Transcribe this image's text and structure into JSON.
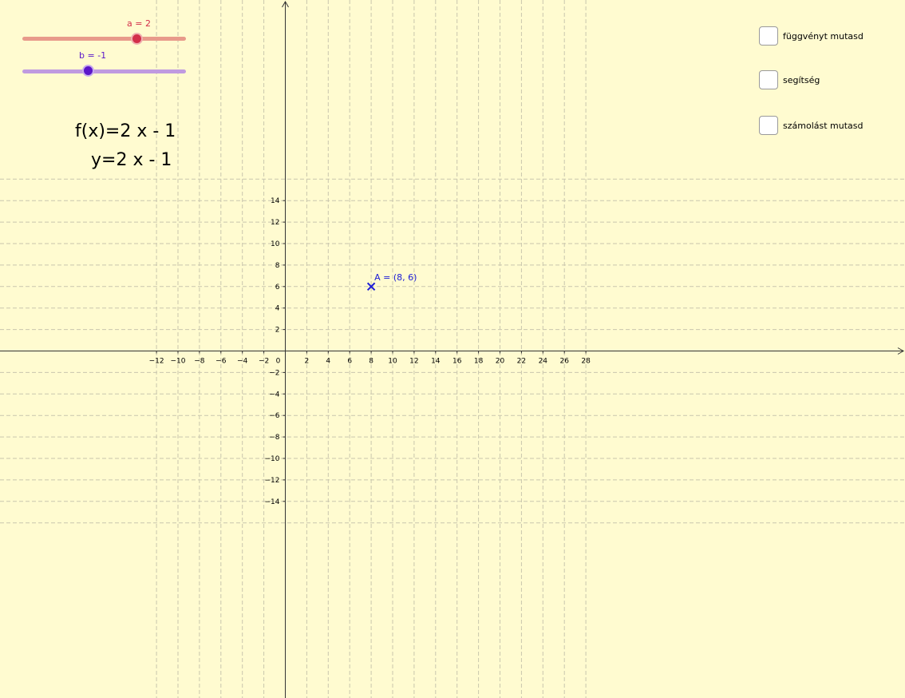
{
  "sliders": {
    "a": {
      "label": "a = 2",
      "value": 2,
      "min": -5,
      "max": 5,
      "color": "#e57373",
      "knob_color": "#d32f4a"
    },
    "b": {
      "label": "b = -1",
      "value": -1,
      "min": -5,
      "max": 5,
      "color": "#b388e0",
      "knob_color": "#5b16c9"
    }
  },
  "formulas": {
    "function": "f(x)=2 x - 1",
    "equation": "y=2 x - 1"
  },
  "checkboxes": [
    {
      "label": "függvényt mutasd",
      "checked": false
    },
    {
      "label": "segítség",
      "checked": false
    },
    {
      "label": "számolást mutasd",
      "checked": false
    }
  ],
  "graph": {
    "background": "#fffbd0",
    "x_range": [
      -13,
      29
    ],
    "y_range": [
      -16,
      16
    ],
    "grid_step": 2,
    "x_ticks": [
      -12,
      -10,
      -8,
      -6,
      -4,
      -2,
      0,
      2,
      4,
      6,
      8,
      10,
      12,
      14,
      16,
      18,
      20,
      22,
      24,
      26,
      28
    ],
    "y_ticks": [
      -14,
      -12,
      -10,
      -8,
      -6,
      -4,
      -2,
      2,
      4,
      6,
      8,
      10,
      12,
      14
    ],
    "point": {
      "label": "A = (8, 6)",
      "x": 8,
      "y": 6,
      "color": "#1b1bd6"
    }
  }
}
